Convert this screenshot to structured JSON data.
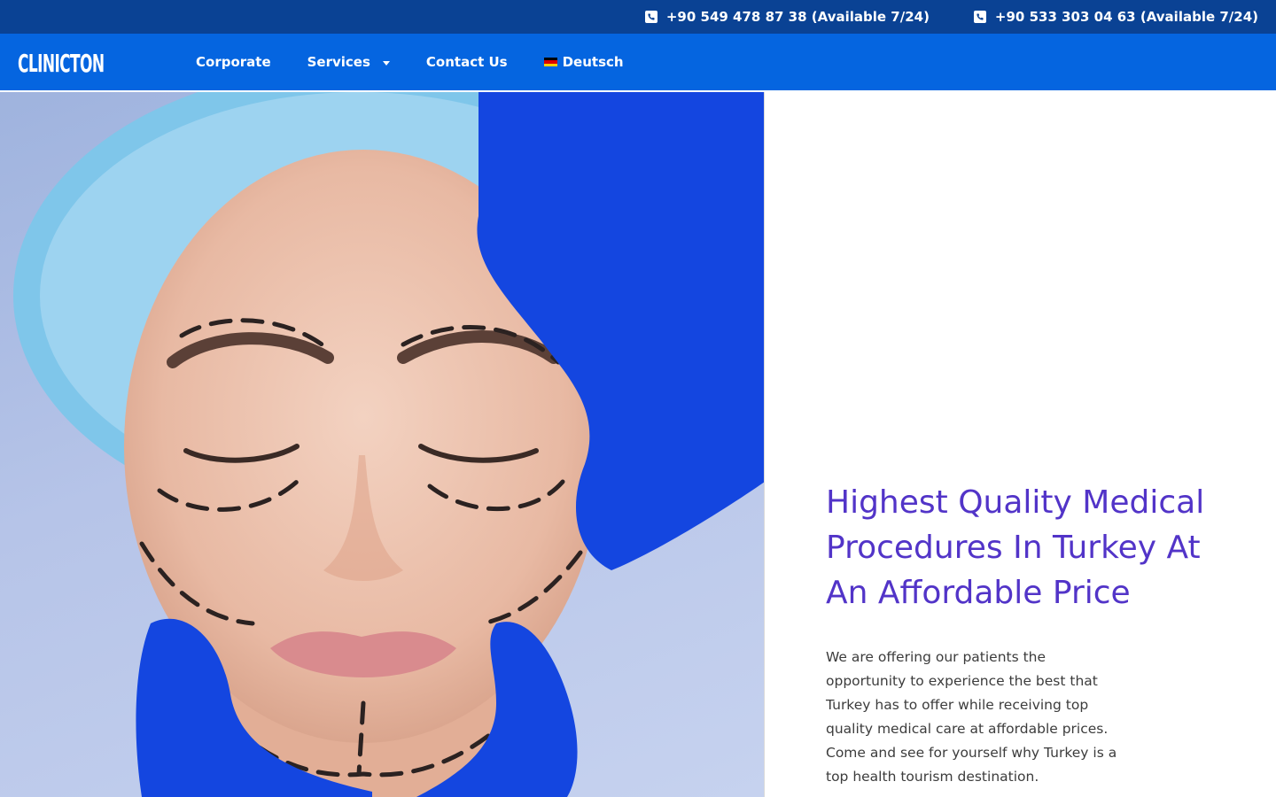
{
  "topbar": {
    "phones": [
      {
        "label": "+90 549 478 87 38 (Available 7/24)"
      },
      {
        "label": "+90 533 303 04 63 (Available 7/24)"
      }
    ],
    "colors": {
      "background": "#0a4294",
      "text": "#ffffff"
    }
  },
  "navbar": {
    "logo": "CLINICTON",
    "items": [
      {
        "label": "Corporate"
      },
      {
        "label": "Services",
        "has_dropdown": true
      },
      {
        "label": "Contact Us"
      },
      {
        "label": "Deutsch",
        "icon": "german-flag-icon"
      }
    ],
    "colors": {
      "background": "#0565e0",
      "text": "#ffffff"
    }
  },
  "hero": {
    "image_description_icon": "surgery-face-markings-image",
    "title": "Highest Quality Medical Procedures In Turkey At An Affordable Price",
    "text": "We are offering our patients the opportunity to experience the best that Turkey has to offer while receiving top quality medical care at affordable prices. Come and see for yourself why Turkey is a top health tourism destination.",
    "colors": {
      "title": "#5234c8",
      "text": "#3c3c3c"
    }
  }
}
